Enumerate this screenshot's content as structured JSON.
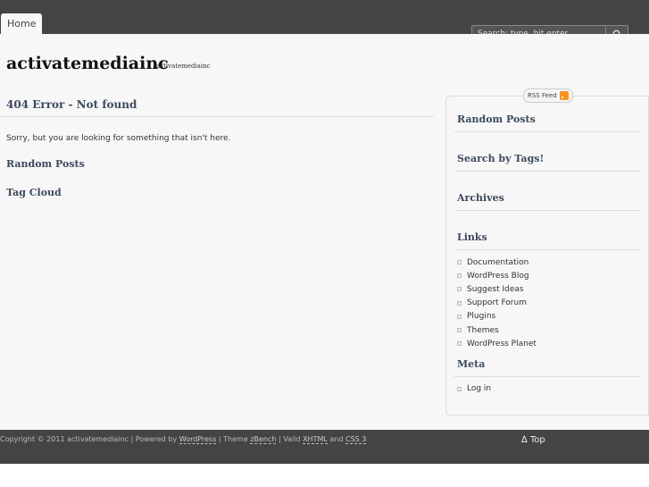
{
  "nav": {
    "home_label": "Home"
  },
  "search": {
    "placeholder": "Search: type, hit enter"
  },
  "site": {
    "title": "activatemediainc",
    "description": "activatemediainc"
  },
  "main": {
    "title": "404 Error - Not found",
    "message": "Sorry, but you are looking for something that isn't here.",
    "random_posts": "Random Posts",
    "tag_cloud": "Tag Cloud"
  },
  "sidebar": {
    "rss_label": "RSS Feed",
    "random_posts": "Random Posts",
    "search_tags": "Search by Tags!",
    "archives": "Archives",
    "links_title": "Links",
    "links": [
      "Documentation",
      "WordPress Blog",
      "Suggest Ideas",
      "Support Forum",
      "Plugins",
      "Themes",
      "WordPress Planet"
    ],
    "meta_title": "Meta",
    "meta_links": [
      "Log in"
    ]
  },
  "footer": {
    "copyright": "Copyright © 2011 activatemediainc",
    "powered_by": "| Powered by",
    "wordpress": "WordPress",
    "theme_text": "| Theme",
    "theme_name": "zBench",
    "valid_text": "| Valid",
    "xhtml": "XHTML",
    "and_text": "and",
    "css": "CSS 3",
    "top_label": "∆ Top"
  }
}
